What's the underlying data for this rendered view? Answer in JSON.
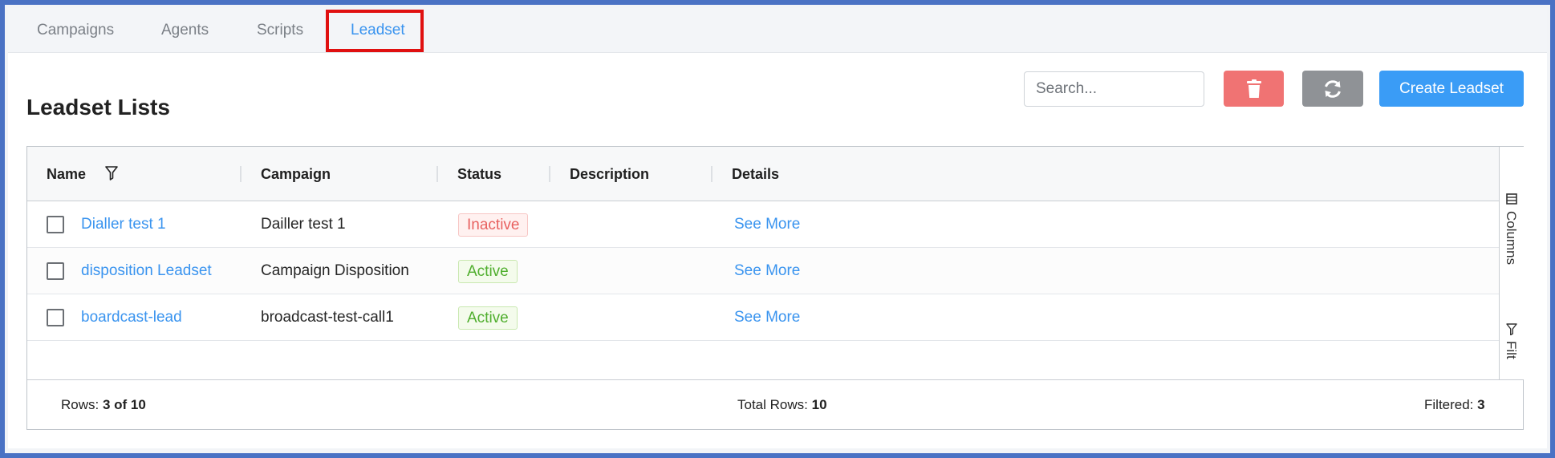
{
  "tabs": [
    {
      "label": "Campaigns"
    },
    {
      "label": "Agents"
    },
    {
      "label": "Scripts"
    },
    {
      "label": "Leadset",
      "active": true
    }
  ],
  "page": {
    "title": "Leadset Lists"
  },
  "toolbar": {
    "search_placeholder": "Search...",
    "search_value": "",
    "delete_icon": "trash-icon",
    "refresh_icon": "refresh-icon",
    "create_label": "Create Leadset"
  },
  "table": {
    "columns": [
      "Name",
      "Campaign",
      "Status",
      "Description",
      "Details"
    ],
    "rows": [
      {
        "name": "Dialler test 1",
        "campaign": "Dailler test 1",
        "status": "Inactive",
        "description": "",
        "details": "See More"
      },
      {
        "name": "disposition Leadset",
        "campaign": "Campaign Disposition",
        "status": "Active",
        "description": "",
        "details": "See More"
      },
      {
        "name": "boardcast-lead",
        "campaign": "broadcast-test-call1",
        "status": "Active",
        "description": "",
        "details": "See More"
      }
    ],
    "sidebar": {
      "columns_label": "Columns",
      "filters_label": "Filt"
    },
    "footer": {
      "rows_label": "Rows:",
      "rows_value": "3 of 10",
      "total_label": "Total Rows:",
      "total_value": "10",
      "filtered_label": "Filtered:",
      "filtered_value": "3"
    }
  },
  "colors": {
    "accent": "#3a94ef",
    "delete": "#f07373",
    "refresh": "#8f9296",
    "create": "#3a9cf6",
    "highlight": "#e01010",
    "inactive": "#e8615f",
    "active": "#4fae2d"
  }
}
